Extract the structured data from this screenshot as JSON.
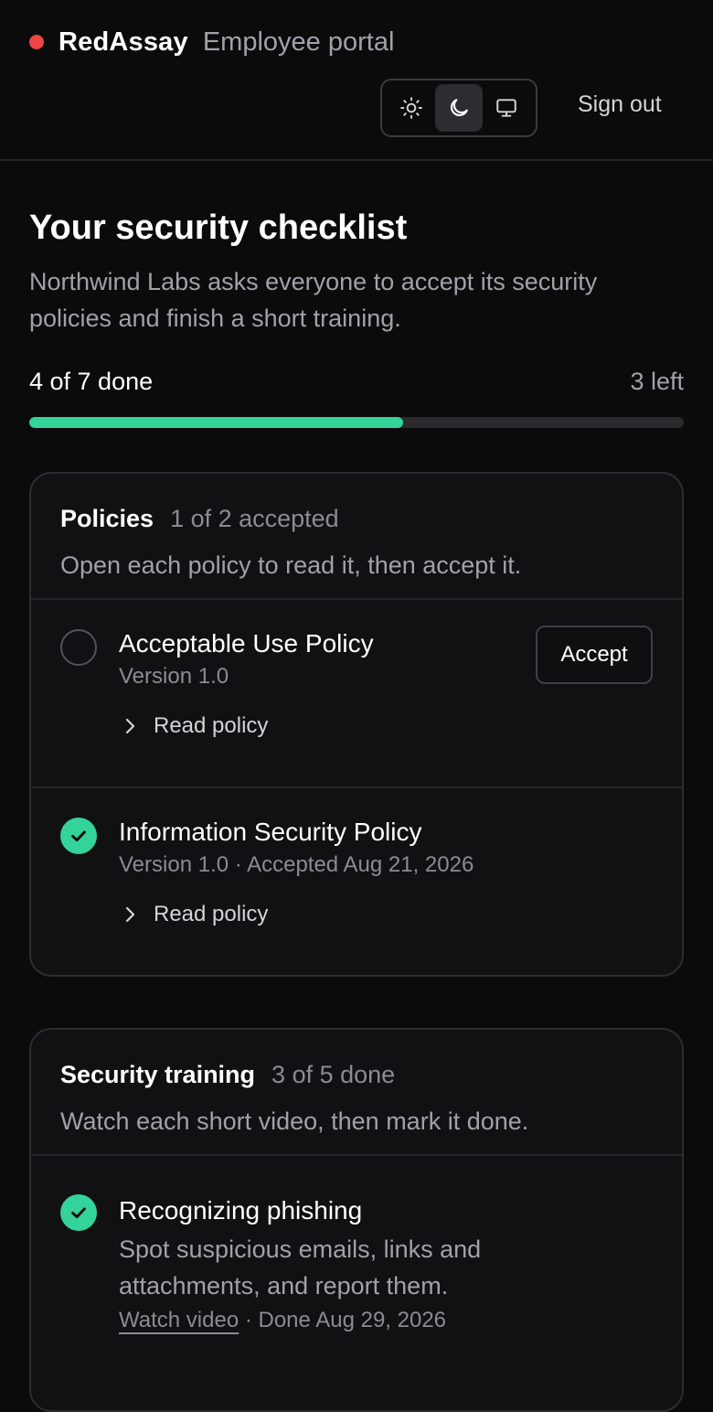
{
  "app": {
    "brand": "RedAssay",
    "subtitle": "Employee portal",
    "sign_out": "Sign out",
    "theme_options": [
      "light",
      "dark",
      "system"
    ],
    "theme_selected": "dark",
    "brand_color": "#ef4444",
    "accent_color": "#34d399"
  },
  "checklist": {
    "title": "Your security checklist",
    "intro": "Northwind Labs asks everyone to accept its security policies and finish a short training.",
    "progress_label": "4 of 7 done",
    "remaining_label": "3 left",
    "progress_fraction": 0.571
  },
  "policies": {
    "title": "Policies",
    "count": "1 of 2 accepted",
    "description": "Open each policy to read it, then accept it.",
    "items": [
      {
        "title": "Acceptable Use Policy",
        "meta": "Version 1.0",
        "status": "pending",
        "action": "Accept",
        "link": "Read policy"
      },
      {
        "title": "Information Security Policy",
        "meta": "Version 1.0 · Accepted Aug 21, 2026",
        "status": "done",
        "link": "Read policy"
      }
    ]
  },
  "training": {
    "title": "Security training",
    "count": "3 of 5 done",
    "description": "Watch each short video, then mark it done.",
    "items": [
      {
        "title": "Recognizing phishing",
        "description": "Spot suspicious emails, links and attachments, and report them.",
        "link": "Watch video",
        "meta": " · Done Aug 29, 2026",
        "status": "done"
      }
    ]
  }
}
